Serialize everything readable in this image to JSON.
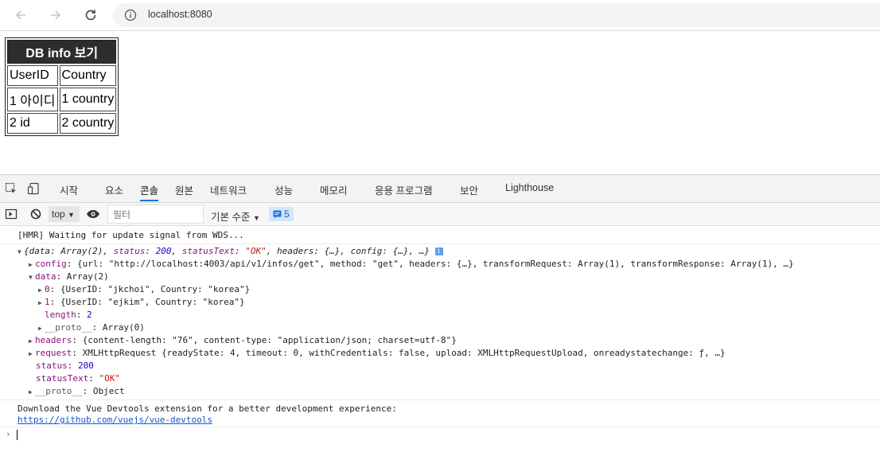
{
  "browser": {
    "url": "localhost:8080"
  },
  "page": {
    "table": {
      "title": "DB info 보기",
      "headers": [
        "UserID",
        "Country"
      ],
      "rows": [
        [
          "1 아이디",
          "1 country"
        ],
        [
          "2 id",
          "2 country"
        ]
      ]
    }
  },
  "devtools": {
    "tabs": [
      "시작",
      "요소",
      "콘솔",
      "원본",
      "네트워크",
      "성능",
      "메모리",
      "응용 프로그램",
      "보안",
      "Lighthouse"
    ],
    "active_tab": "콘솔",
    "toolbar": {
      "context": "top",
      "filter_placeholder": "필터",
      "level": "기본 수준",
      "message_count": "5"
    },
    "console": {
      "hmr": "[HMR] Waiting for update signal from WDS...",
      "resp_summary_open": "{data: Array(2), ",
      "status_key": "status",
      "status_val": "200",
      "status_text_key": "statusText",
      "status_text_val": "\"OK\"",
      "resp_summary_rest": "headers: {…}, config: {…}, …}",
      "config_key": "config",
      "config_val": "{url: \"http://localhost:4003/api/v1/infos/get\", method: \"get\", headers: {…}, transformRequest: Array(1), transformResponse: Array(1), …}",
      "data_key": "data",
      "data_val": "Array(2)",
      "item0_key": "0",
      "item0_val": "{UserID: \"jkchoi\", Country: \"korea\"}",
      "item1_key": "1",
      "item1_val": "{UserID: \"ejkim\", Country: \"korea\"}",
      "length_key": "length",
      "length_val": "2",
      "proto_key": "__proto__",
      "proto_arr_val": "Array(0)",
      "headers_key": "headers",
      "headers_val": "{content-length: \"76\", content-type: \"application/json; charset=utf-8\"}",
      "request_key": "request",
      "request_val": "XMLHttpRequest {readyState: 4, timeout: 0, withCredentials: false, upload: XMLHttpRequestUpload, onreadystatechange: ƒ, …}",
      "status_line_key": "status",
      "status_line_val": "200",
      "statustext_line_key": "statusText",
      "statustext_line_val": "\"OK\"",
      "proto_obj_val": "Object",
      "vue_msg": "Download the Vue Devtools extension for a better development experience:",
      "vue_link": "https://github.com/vuejs/vue-devtools"
    }
  }
}
